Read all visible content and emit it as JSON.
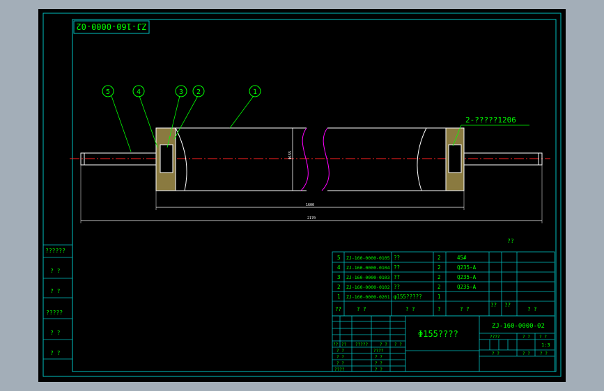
{
  "title_box": "ZJ-160-0000-02",
  "balloons": [
    "5",
    "4",
    "3",
    "2",
    "1"
  ],
  "bearing_callout": "2-?????1206",
  "dimensions": {
    "diameter": "Φ155",
    "length_inner": "1600",
    "length_overall": "2170"
  },
  "note": "??",
  "parts": [
    {
      "no": "5",
      "code": "ZJ-160-0000-0105",
      "name": "??",
      "qty": "2",
      "material": "45#"
    },
    {
      "no": "4",
      "code": "ZJ-160-0000-0104",
      "name": "??",
      "qty": "2",
      "material": "Q235-A"
    },
    {
      "no": "3",
      "code": "ZJ-160-0000-0103",
      "name": "??",
      "qty": "2",
      "material": "Q235-A"
    },
    {
      "no": "2",
      "code": "ZJ-160-0000-0102",
      "name": "??",
      "qty": "2",
      "material": "Q235-A"
    },
    {
      "no": "1",
      "code": "ZJ-160-0000-0201",
      "name": "φ155?????",
      "qty": "1",
      "material": ""
    }
  ],
  "parts_header": [
    "??",
    "?  ?",
    "?  ?",
    "?",
    "?  ?",
    "??",
    "??",
    "?  ?"
  ],
  "title_block": {
    "name": "Φ155????",
    "drawing_no": "ZJ-160-0000-02",
    "scale_header": [
      "????",
      "?  ?",
      "?  ?"
    ],
    "scale_value": "1:3",
    "footer_cells": [
      "?  ?",
      "?  ?",
      "?  ?"
    ]
  },
  "signature_rows": {
    "header": [
      "??",
      "??",
      "?????",
      "?  ?",
      "?  ?"
    ],
    "rows": [
      [
        "?  ?",
        "????"
      ],
      [
        "? ?",
        "? ?"
      ],
      [
        "? ?",
        "? ?"
      ],
      [
        "????",
        "? ?"
      ]
    ]
  },
  "side_labels": [
    "??????",
    "?  ?",
    "?  ?",
    "?????",
    "?  ?",
    "?  ?"
  ]
}
